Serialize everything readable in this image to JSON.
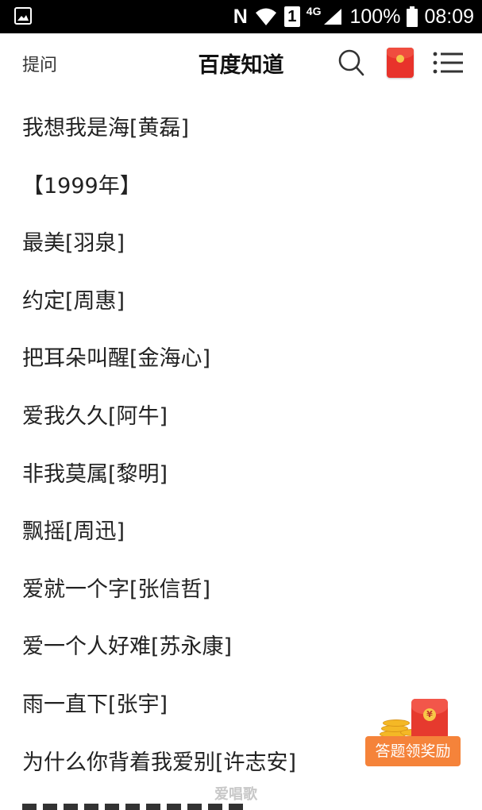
{
  "status_bar": {
    "battery": "100%",
    "time": "08:09",
    "network_type": "4G",
    "sim_slot": "1",
    "notification_letter": "N",
    "icons": [
      "image-icon",
      "wifi-icon",
      "signal-icon",
      "battery-icon"
    ]
  },
  "header": {
    "ask_label": "提问",
    "title": "百度知道",
    "icons": [
      "search-icon",
      "red-envelope-icon",
      "menu-icon"
    ]
  },
  "content": {
    "lines": [
      "我想我是海[黄磊]",
      "【1999年】",
      "最美[羽泉]",
      "约定[周惠]",
      "把耳朵叫醒[金海心]",
      "爱我久久[阿牛]",
      "非我莫属[黎明]",
      "飘摇[周迅]",
      "爱就一个字[张信哲]",
      "爱一个人好难[苏永康]",
      "雨一直下[张宇]",
      "为什么你背着我爱别[许志安]"
    ]
  },
  "reward": {
    "button_label": "答题领奖励",
    "coin_symbol": "¥",
    "colors": {
      "button": "#f5833a",
      "envelope": "#e63a2e"
    }
  },
  "watermark": "爱唱歌"
}
